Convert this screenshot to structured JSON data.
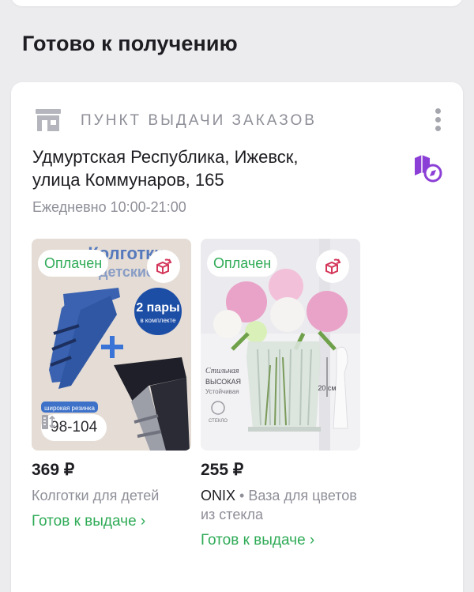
{
  "section": {
    "title": "Готово к получению"
  },
  "pickup": {
    "label": "ПУНКТ ВЫДАЧИ ЗАКАЗОВ",
    "address_line1": "Удмуртская Республика, Ижевск,",
    "address_line2": "улица Коммунаров, 165",
    "hours": "Ежедневно 10:00-21:00",
    "icons": {
      "store": "store-icon",
      "more": "more-vertical-icon",
      "map": "map-compass-icon"
    }
  },
  "products": [
    {
      "badge": "Оплачен",
      "image_text": {
        "title_line1": "Колготки",
        "title_line2": "детские",
        "pairs": "2 пары",
        "pairs_sub": "в комплекте",
        "note": "широкая резинка"
      },
      "size": "98-104",
      "price": "369 ₽",
      "name": "Колготки для детей",
      "status": "Готов к выдаче ›"
    },
    {
      "badge": "Оплачен",
      "image_text": {
        "line1": "Стильная",
        "line2": "ВЫСОКАЯ",
        "line3": "Устойчивая",
        "line4": "СТЕКЛО",
        "height": "20 см"
      },
      "price": "255 ₽",
      "brand": "ONIX",
      "name": "• Ваза для цветов из стекла",
      "status": "Готов к выдаче ›"
    }
  ],
  "colors": {
    "accent_green": "#2fab57",
    "accent_purple": "#8b3fd6",
    "muted": "#8e8f98",
    "return_icon": "#d4365a"
  }
}
